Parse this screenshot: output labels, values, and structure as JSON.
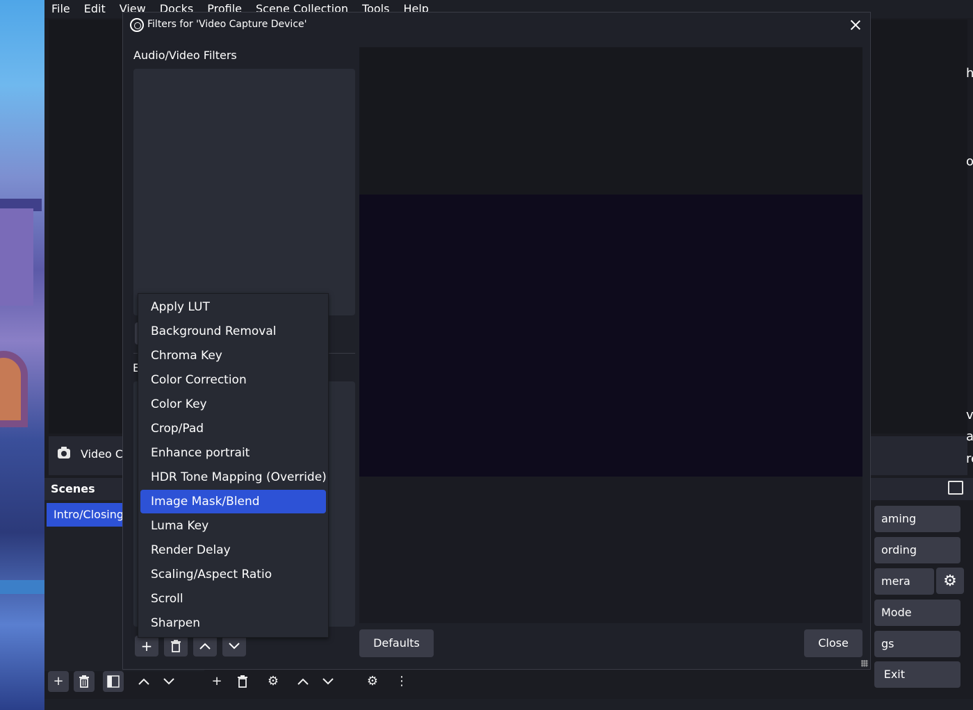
{
  "main_window": {
    "menu": [
      "File",
      "Edit",
      "View",
      "Docks",
      "Profile",
      "Scene Collection",
      "Tools",
      "Help"
    ],
    "source_label": "Video Ca",
    "scenes_dock": {
      "title": "Scenes",
      "items": [
        "Intro/Closing"
      ]
    },
    "controls_dock": {
      "buttons": [
        "aming",
        "ording",
        "mera",
        "Mode",
        "gs",
        "Exit"
      ]
    },
    "right_edge_texts": [
      "hi",
      "ok",
      "ve",
      "al",
      "re"
    ]
  },
  "dialog": {
    "title": "Filters for 'Video Capture Device'",
    "audio_video_label": "Audio/Video Filters",
    "effect_label_partial": "E",
    "defaults_label": "Defaults",
    "close_label": "Close"
  },
  "dropdown": {
    "options": [
      "Apply LUT",
      "Background Removal",
      "Chroma Key",
      "Color Correction",
      "Color Key",
      "Crop/Pad",
      "Enhance portrait",
      "HDR Tone Mapping (Override)",
      "Image Mask/Blend",
      "Luma Key",
      "Render Delay",
      "Scaling/Aspect Ratio",
      "Scroll",
      "Sharpen"
    ],
    "selected": "Image Mask/Blend"
  },
  "icons": {
    "add": "+",
    "remove": "trash-icon",
    "up": "chevron-up-icon",
    "down": "chevron-down-icon",
    "gear": "⚙",
    "more": "⋮"
  },
  "colors": {
    "accent": "#2d52d6",
    "panel": "#2a2d37",
    "button": "#3a3c48"
  }
}
